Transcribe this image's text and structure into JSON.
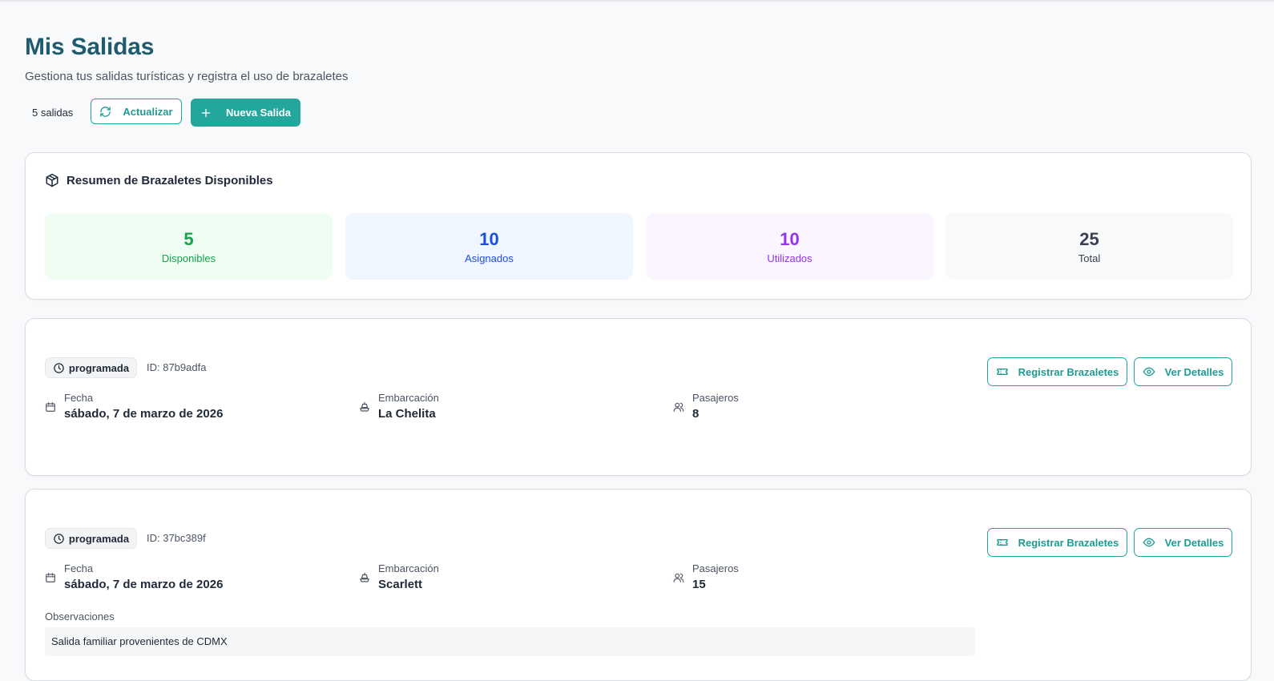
{
  "header": {
    "title": "Mis Salidas",
    "subtitle": "Gestiona tus salidas turísticas y registra el uso de brazaletes",
    "count_label": "5 salidas",
    "refresh_label": "Actualizar",
    "new_label": "Nueva Salida"
  },
  "summary": {
    "title": "Resumen de Brazaletes Disponibles",
    "stats": [
      {
        "value": "5",
        "label": "Disponibles",
        "color": "#16a34a",
        "bg": "#effdf3"
      },
      {
        "value": "10",
        "label": "Asignados",
        "color": "#1d4ed8",
        "bg": "#eff6ff"
      },
      {
        "value": "10",
        "label": "Utilizados",
        "color": "#9333ea",
        "bg": "#faf5ff"
      },
      {
        "value": "25",
        "label": "Total",
        "color": "#374151",
        "bg": "#f8f9fb"
      }
    ]
  },
  "trips": [
    {
      "status": "programada",
      "id": "ID: 87b9adfa",
      "date_label": "Fecha",
      "date": "sábado, 7 de marzo de 2026",
      "boat_label": "Embarcación",
      "boat": "La Chelita",
      "pax_label": "Pasajeros",
      "pax": "8",
      "register_label": "Registrar Brazaletes",
      "details_label": "Ver Detalles"
    },
    {
      "status": "programada",
      "id": "ID: 37bc389f",
      "date_label": "Fecha",
      "date": "sábado, 7 de marzo de 2026",
      "boat_label": "Embarcación",
      "boat": "Scarlett",
      "pax_label": "Pasajeros",
      "pax": "15",
      "register_label": "Registrar Brazaletes",
      "details_label": "Ver Detalles",
      "obs_label": "Observaciones",
      "obs": "Salida familiar provenientes de CDMX"
    }
  ],
  "colors": {
    "accent": "#23a79d",
    "title": "#1e5b6e"
  }
}
